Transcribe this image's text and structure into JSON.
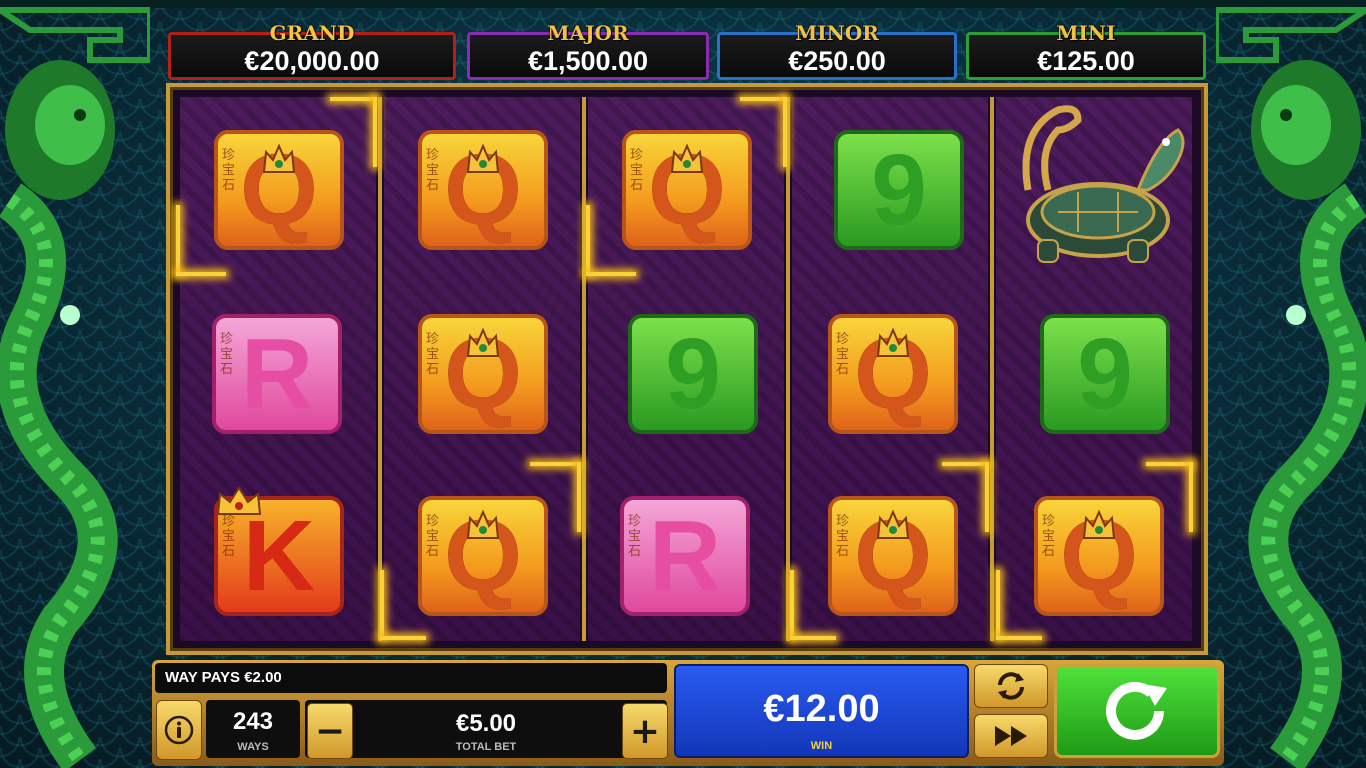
{
  "jackpots": {
    "grand": {
      "label": "GRAND",
      "value": "€20,000.00"
    },
    "major": {
      "label": "MAJOR",
      "value": "€1,500.00"
    },
    "minor": {
      "label": "MINOR",
      "value": "€250.00"
    },
    "mini": {
      "label": "MINI",
      "value": "€125.00"
    }
  },
  "reels": [
    [
      "Q",
      "R",
      "K"
    ],
    [
      "Q",
      "Q",
      "Q"
    ],
    [
      "Q",
      "9",
      "R"
    ],
    [
      "9",
      "Q",
      "Q"
    ],
    [
      "turtle-dragon",
      "9",
      "Q"
    ]
  ],
  "symbol_chars": "珍宝石",
  "status": {
    "message": "WAY PAYS €2.00"
  },
  "ways": {
    "value": "243",
    "label": "WAYS"
  },
  "bet": {
    "value": "€5.00",
    "label": "TOTAL BET",
    "minus": "−",
    "plus": "+"
  },
  "win": {
    "value": "€12.00",
    "label": "WIN"
  },
  "colors": {
    "grand": "#b3201a",
    "major": "#8a2ab5",
    "minor": "#2a6fc8",
    "mini": "#2d9d35",
    "win_panel": "#1a47d6",
    "spin": "#2fbf22",
    "gold": "#c49a3a"
  },
  "icons": {
    "info": "info-icon",
    "autoplay": "autoplay-icon",
    "turbo": "fast-forward-icon",
    "spin": "spin-icon"
  }
}
